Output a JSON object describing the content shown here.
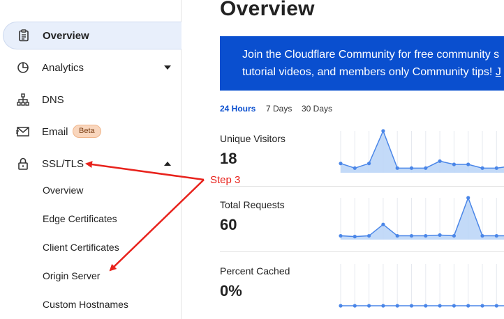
{
  "sidebar": {
    "items": [
      {
        "label": "Overview",
        "icon": "clipboard-icon",
        "active": true
      },
      {
        "label": "Analytics",
        "icon": "pie-chart-icon",
        "caret": "chevron-down-icon"
      },
      {
        "label": "DNS",
        "icon": "network-icon"
      },
      {
        "label": "Email",
        "icon": "envelope-icon",
        "badge": "Beta"
      },
      {
        "label": "SSL/TLS",
        "icon": "lock-icon",
        "caret": "chevron-up-icon"
      }
    ],
    "ssl_sub_items": [
      "Overview",
      "Edge Certificates",
      "Client Certificates",
      "Origin Server",
      "Custom Hostnames"
    ]
  },
  "main": {
    "title": "Overview",
    "banner": {
      "line1": "Join the Cloudflare Community for free community s",
      "line2_text": "tutorial videos, and members only Community tips! ",
      "line2_link": "J"
    },
    "time_ranges": [
      {
        "label": "24 Hours",
        "selected": true
      },
      {
        "label": "7 Days",
        "selected": false
      },
      {
        "label": "30 Days",
        "selected": false
      }
    ],
    "metrics": [
      {
        "label": "Unique Visitors",
        "value": "18",
        "series": [
          2,
          1,
          2,
          9,
          1,
          1,
          1,
          2.5,
          1.8,
          1.8,
          1,
          1,
          1.4
        ]
      },
      {
        "label": "Total Requests",
        "value": "60",
        "series": [
          1,
          0.8,
          1,
          4,
          1,
          1,
          1,
          1.2,
          1,
          11,
          1,
          1,
          1
        ]
      },
      {
        "label": "Percent Cached",
        "value": "0%",
        "series": [
          0,
          0,
          0,
          0,
          0,
          0,
          0,
          0,
          0,
          0,
          0,
          0,
          0
        ]
      }
    ]
  },
  "annotation": {
    "label": "Step 3",
    "color": "#e8221c"
  },
  "colors": {
    "accent": "#0a4fcf",
    "spark_line": "#4a86e8",
    "spark_fill": "#b9d3f7",
    "active_bg": "#e8effb"
  }
}
